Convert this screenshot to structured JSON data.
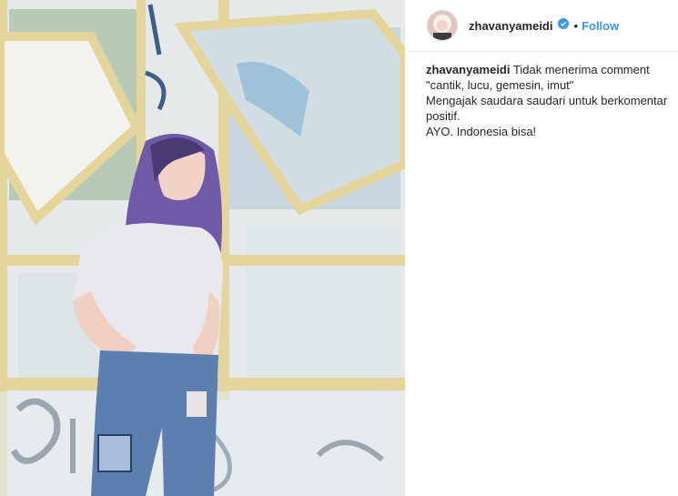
{
  "post": {
    "username": "zhavanyameidi",
    "separator": "•",
    "follow_label": "Follow"
  },
  "caption": {
    "username": "zhavanyameidi",
    "line1": "Tidak menerima comment",
    "line2": "\"cantik, lucu, gemesin, imut\"",
    "line3": "Mengajak saudara saudari untuk berkomentar positif.",
    "line4": "AYO. Indonesia bisa!"
  },
  "icons": {
    "verified": "verified-badge-icon"
  },
  "colors": {
    "follow": "#3897f0",
    "verified": "#3897f0",
    "text": "#262626"
  }
}
